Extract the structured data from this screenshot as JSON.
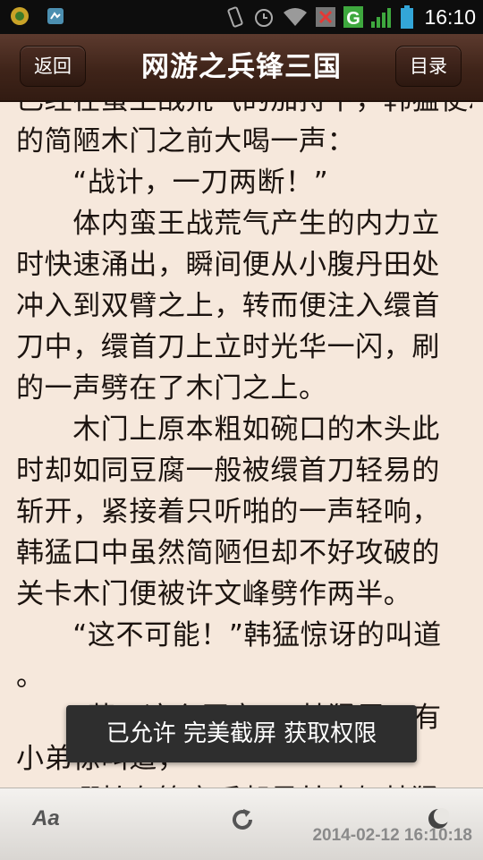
{
  "status_bar": {
    "time": "16:10",
    "network_type": "G",
    "left_icons": [
      "app-notification-icon",
      "screenshot-app-icon"
    ],
    "right_icons": [
      "vibrate-icon",
      "alarm-icon",
      "wifi-icon",
      "sim1-no-signal-icon",
      "signal-icon",
      "battery-icon"
    ]
  },
  "header": {
    "back_label": "返回",
    "title": "网游之兵锋三国",
    "toc_label": "目录"
  },
  "content": {
    "lines": [
      "已经在蛮王战荒气的加持下，韩猛使冲向关卡",
      "的简陋木门之前大喝一声：",
      "　　“战计，一刀两断！”",
      "　　体内蛮王战荒气产生的内力立",
      "时快速涌出，瞬间便从小腹丹田处",
      "冲入到双臂之上，转而便注入缳首",
      "刀中，缳首刀上立时光华一闪，刷",
      "的一声劈在了木门之上。",
      "　　木门上原本粗如碗口的木头此",
      "时却如同豆腐一般被缳首刀轻易的",
      "斩开，紧接着只听啪的一声轻响，",
      "韩猛口中虽然简陋但却不好攻破的",
      "关卡木门便被许文峰劈作两半。",
      "　　“这不可能！”韩猛惊讶的叫道",
      "。",
      "　　“草，这么厉害！”韩猛属下有",
      "小弟惊叫道，",
      "　　哪怕有等变后却是甘未如韩猛"
    ]
  },
  "toast": {
    "message": "已允许 完美截屏 获取权限"
  },
  "bottom_bar": {
    "font_label": "Aa",
    "timestamp": "2014-02-12 16:10:18"
  },
  "colors": {
    "page_background": "#f6e8dc",
    "title_bar": "#3f2419",
    "text": "#1c1410",
    "toast": "#2e2e2e"
  }
}
